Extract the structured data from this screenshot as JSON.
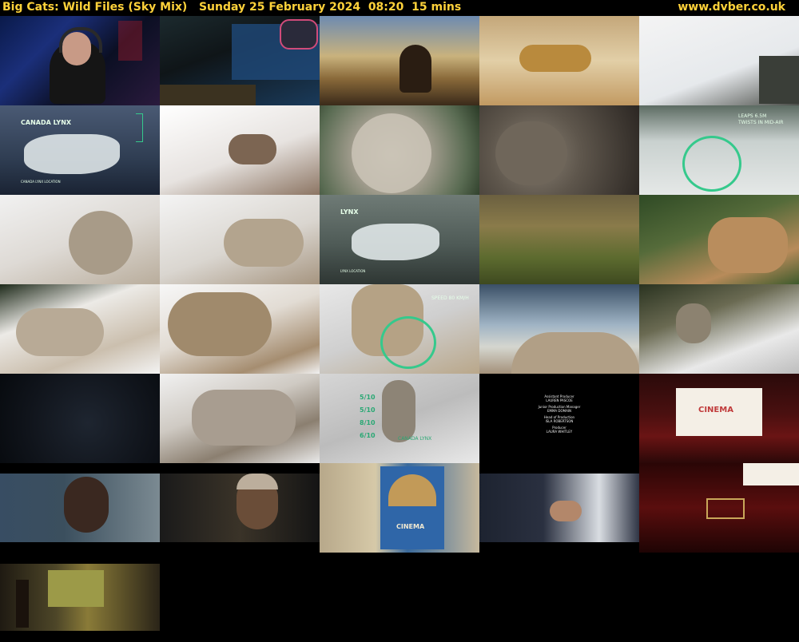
{
  "header": {
    "title": "Big Cats: Wild Files (Sky Mix)   Sunday 25 February 2024  08:20  15 mins",
    "site": "www.dvber.co.uk"
  },
  "overlays": {
    "canada_lynx_title": "CANADA LYNX",
    "lynx_title": "LYNX",
    "canada_lynx_location": "CANADA LYNX LOCATION",
    "lynx_location": "LYNX LOCATION",
    "leaps_stat": "LEAPS 6.5M",
    "twists_stat": "TWISTS IN MID-AIR",
    "speed_stat": "SPEED 80 KM/H",
    "rating1": "5/10",
    "rating2": "5/10",
    "rating3": "8/10",
    "rating4": "6/10",
    "canada_lynx_badge": "CANADA LYNX",
    "cinema_word": "CINEMA",
    "credits": [
      "Assistant Producer",
      "LAUREN PASCOE",
      "Junior Production Manager",
      "EMMA DOMAIN",
      "Head of Production",
      "ISLA ROBERTSON",
      "Producer",
      "LAURA WHITLEY"
    ]
  },
  "thumbnails": [
    {
      "label": "presenter-webcam",
      "bg": "linear-gradient(135deg,#0a1a4a 0%,#1b2f7a 30%,#0b0f23 60%,#2a1a3d 100%)"
    },
    {
      "label": "game-ui",
      "bg": "linear-gradient(160deg,#1c2a2e 0%,#0f1518 40%,#1a3a5a 100%)"
    },
    {
      "label": "sunset-serval",
      "bg": "linear-gradient(180deg,#6d8bb1 0%,#c9b27d 45%,#8a6a3a 70%,#3a2a1a 100%)"
    },
    {
      "label": "running-cheetah",
      "bg": "linear-gradient(180deg,#c4a77a 0%,#e2cfa7 50%,#c29a62 100%)"
    },
    {
      "label": "snow-creature",
      "bg": "linear-gradient(160deg,#f4f4f4 0%,#e6e9ec 60%,#4a4d48 100%)"
    },
    {
      "label": "canada-lynx-map",
      "bg": "linear-gradient(180deg,#4a5a74 0%,#2f3d52 60%,#1a2333 100%)"
    },
    {
      "label": "lynx-paws-snow",
      "bg": "linear-gradient(160deg,#ffffff 0%,#e7e3e0 55%,#8c7563 100%)"
    },
    {
      "label": "lynx-face",
      "bg": "radial-gradient(circle at 45% 55%,#d8d2c5 0%,#a8a193 35%,#596b52 75%,#2a3a26 100%)"
    },
    {
      "label": "lynx-closeup",
      "bg": "radial-gradient(circle at 35% 55%,#8a8174 0%,#5e564c 40%,#2b2622 100%)"
    },
    {
      "label": "leaps-graphic",
      "bg": "linear-gradient(180deg,#5c6b62 0%,#c9d1cf 40%,#e5e8e7 100%)"
    },
    {
      "label": "lynx-sitting-snow",
      "bg": "linear-gradient(160deg,#f1f1f1 0%,#dedad5 50%,#b9ad9c 100%)"
    },
    {
      "label": "lynx-walking-snow",
      "bg": "linear-gradient(160deg,#f4f4f4 0%,#dad6d0 55%,#a69580 100%)"
    },
    {
      "label": "lynx-map",
      "bg": "linear-gradient(180deg,#6f7b76 0%,#4f5b57 55%,#2e3633 100%)"
    },
    {
      "label": "grass-forest",
      "bg": "linear-gradient(180deg,#6b6040 0%,#8a7b4a 35%,#5d6b2f 70%,#3e4a20 100%)"
    },
    {
      "label": "deer-forest",
      "bg": "linear-gradient(160deg,#2f4a25 0%,#556b3a 40%,#b88b5a 75%,#3d5a2c 100%)"
    },
    {
      "label": "lynx-stalking-snow",
      "bg": "linear-gradient(160deg,#1e2a1a 0%,#eceae6 35%,#cbbfae 70%,#f3f3f3 100%)"
    },
    {
      "label": "lynx-legs-snow",
      "bg": "linear-gradient(160deg,#f7f7f7 0%,#e2dcd4 45%,#a58d70 80%,#f1f1f1 100%)"
    },
    {
      "label": "speed-graphic",
      "bg": "linear-gradient(160deg,#e8e8e8 0%,#cfcfcf 50%,#b9a78a 100%)"
    },
    {
      "label": "lynx-tail",
      "bg": "linear-gradient(180deg,#3a4f66 0%,#9fb3c4 45%,#d5d6cf 70%,#a4917a 100%)"
    },
    {
      "label": "lynx-forest-snow",
      "bg": "linear-gradient(160deg,#2a3320 0%,#6a6a52 35%,#e9e9e9 70%,#bdbdbd 100%)"
    },
    {
      "label": "dark-forest",
      "bg": "radial-gradient(circle at 55% 55%,#1e2530 0%,#10141b 60%,#070a0e 100%)"
    },
    {
      "label": "lynx-snow-walk",
      "bg": "linear-gradient(160deg,#f1f1f1 0%,#cfcac3 40%,#8b7f70 70%,#eaeaea 100%)"
    },
    {
      "label": "ratings-graphic",
      "bg": "linear-gradient(160deg,#d6d6d6 0%,#bcbcbc 50%,#e9e9e9 100%)"
    },
    {
      "label": "credits",
      "bg": "#000"
    },
    {
      "label": "cinema-screen",
      "bg": "linear-gradient(180deg,#2a0a0a 0%,#4a1010 45%,#6a1414 70%,#2a0808 100%)"
    },
    {
      "label": "man-speaking",
      "bg": "linear-gradient(90deg,#384d63 0%,#3b4f5e 40%,#7b8a92 100%)"
    },
    {
      "label": "man-cap",
      "bg": "linear-gradient(90deg,#1a1a1a 0%,#3a3328 50%,#141414 100%)"
    },
    {
      "label": "cinema-poster-room",
      "bg": "linear-gradient(90deg,#b7a88a 0%,#d6c9a8 35%,#3a6a9c 55%,#c7b99d 100%)"
    },
    {
      "label": "handshake",
      "bg": "linear-gradient(90deg,#1d2330 0%,#2a3040 40%,#d9dde2 75%,#2f3545 100%)"
    },
    {
      "label": "cinema-seats",
      "bg": "linear-gradient(180deg,#2a0606 0%,#5a0e0e 50%,#1e0404 100%)"
    },
    {
      "label": "dark-room-window",
      "bg": "linear-gradient(90deg,#1f1a12 0%,#4d4628 35%,#8a7b38 55%,#2a2418 100%)"
    }
  ]
}
